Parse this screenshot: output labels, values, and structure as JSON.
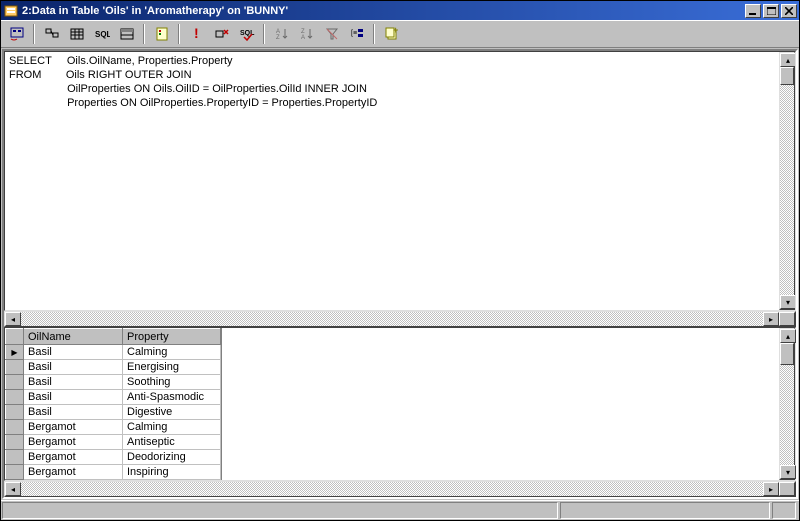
{
  "title": "2:Data in Table 'Oils' in 'Aromatherapy' on 'BUNNY'",
  "sql": {
    "line1_kw": "SELECT",
    "line1_rest": "     Oils.OilName, Properties.Property",
    "line2_kw": "FROM",
    "line2_rest": "        Oils RIGHT OUTER JOIN",
    "line3": "                   OilProperties ON Oils.OilID = OilProperties.OilId INNER JOIN",
    "line4": "                   Properties ON OilProperties.PropertyID = Properties.PropertyID"
  },
  "grid": {
    "cols": [
      "OilName",
      "Property"
    ],
    "rows": [
      [
        "Basil",
        "Calming"
      ],
      [
        "Basil",
        "Energising"
      ],
      [
        "Basil",
        "Soothing"
      ],
      [
        "Basil",
        "Anti-Spasmodic"
      ],
      [
        "Basil",
        "Digestive"
      ],
      [
        "Bergamot",
        "Calming"
      ],
      [
        "Bergamot",
        "Antiseptic"
      ],
      [
        "Bergamot",
        "Deodorizing"
      ],
      [
        "Bergamot",
        "Inspiring"
      ]
    ]
  },
  "toolbar_icons": [
    "diagram-pane-icon",
    "show-hide-icon",
    "grid-pane-icon",
    "sql-pane-icon",
    "results-pane-icon",
    "sep",
    "run-icon",
    "sep",
    "stop-icon",
    "verify-sql-icon",
    "cancel-sql-icon",
    "sep",
    "sort-asc-icon",
    "sort-desc-icon",
    "filter-icon",
    "group-icon",
    "sep",
    "add-table-icon"
  ]
}
